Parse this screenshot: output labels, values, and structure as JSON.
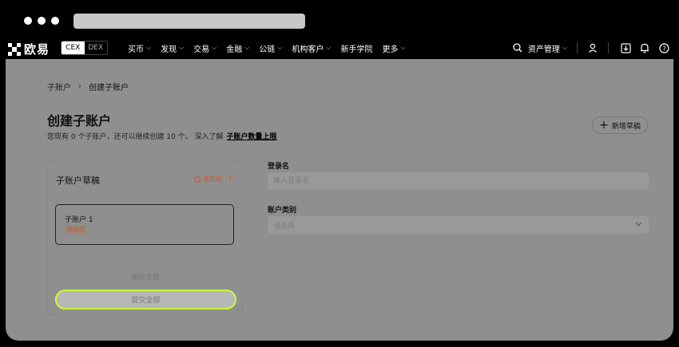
{
  "nav": {
    "logo_text": "欧易",
    "seg": {
      "cex": "CEX",
      "dex": "DEX"
    },
    "menu": [
      "买币",
      "发现",
      "交易",
      "金融",
      "公链",
      "机构客户",
      "新手学院",
      "更多"
    ],
    "menu_has_chevron": [
      true,
      true,
      true,
      true,
      true,
      true,
      false,
      true
    ],
    "asset_label": "资产管理"
  },
  "breadcrumb": {
    "parent": "子账户",
    "sep": "›",
    "current": "创建子账户"
  },
  "page": {
    "title": "创建子账户",
    "subtitle": "您现有 0 个子账户，还可以继续创建 10 个。 深入了解",
    "subtitle_link": "子账户数量上限",
    "new_draft_label": "新增草稿"
  },
  "drafts": {
    "title": "子账户草稿",
    "status": "未完成 · 1",
    "items": [
      {
        "name": "子账户 1",
        "badge": "未完成"
      }
    ],
    "save_all": "保存全部",
    "submit_all": "提交全部"
  },
  "form": {
    "login_label": "登录名",
    "login_placeholder": "输入登录名",
    "type_label": "账户类别",
    "type_placeholder": "请选择"
  },
  "colors": {
    "accent": "#c4ff32",
    "warning": "#c06030"
  }
}
